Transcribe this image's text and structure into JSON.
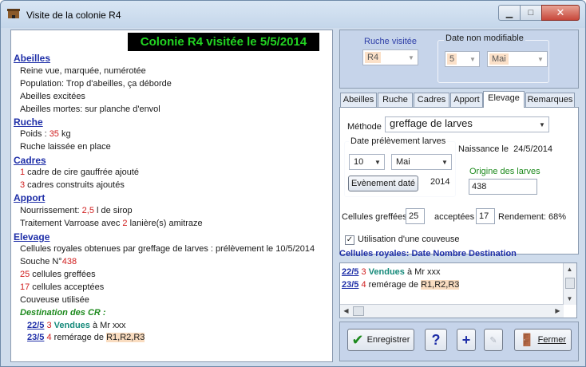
{
  "window": {
    "title": "Visite de la colonie R4"
  },
  "left": {
    "banner": "Colonie R4 visitée le 5/5/2014",
    "abeilles": {
      "heading": "Abeilles",
      "lines": [
        "Reine vue, marquée, numérotée",
        "Population: Trop d'abeilles, ça déborde",
        "Abeilles excitées",
        "Abeilles mortes:  sur planche d'envol"
      ]
    },
    "ruche": {
      "heading": "Ruche",
      "poids_label": "Poids : ",
      "poids_value": "35",
      "poids_unit": "  kg",
      "line2": "Ruche laissée en place"
    },
    "cadres": {
      "heading": "Cadres",
      "l1_num": "1",
      "l1_text": " cadre de cire gauffrée ajouté",
      "l2_num": "3",
      "l2_text": " cadres construits ajoutés"
    },
    "apport": {
      "heading": "Apport",
      "l1_label": "Nourrissement: ",
      "l1_value": "2,5",
      "l1_unit": "  l de sirop",
      "l2_label": "Traitement Varroase avec ",
      "l2_value": "2",
      "l2_unit": "  lanière(s) amitraze"
    },
    "elevage": {
      "heading": "Elevage",
      "l1": "Cellules royales obtenues par greffage de larves :  prélèvement  le 10/5/2014",
      "l2_label": "Souche N°",
      "l2_value": "438",
      "l3_num": "25",
      "l3_text": " cellules greffées",
      "l4_num": "17",
      "l4_text": " cellules acceptées",
      "l5": "Couveuse utilisée",
      "dest_title": "Destination des CR :",
      "d1_date": "22/5",
      "d1_num": "3",
      "d1_status": "Vendues",
      "d1_rest": " à Mr xxx",
      "d2_date": "23/5",
      "d2_num": "4",
      "d2_status": " remérage de ",
      "d2_target": "R1,R2,R3"
    }
  },
  "right": {
    "ruche_visitee_label": "Ruche visitée",
    "ruche_visitee_value": "R4",
    "date_label": "Date non modifiable",
    "date_day": "5",
    "date_month": "Mai",
    "tabs": [
      "Abeilles",
      "Ruche",
      "Cadres",
      "Apport",
      "Elevage",
      "Remarques"
    ],
    "active_tab": "Elevage",
    "methode_label": "Méthode",
    "methode_value": "greffage de larves",
    "prelevement_label": "Date prélèvement larves",
    "prel_day": "10",
    "prel_month": "Mai",
    "prel_year": "2014",
    "event_button": "Evènement daté",
    "naissance_label": "Naissance le",
    "naissance_value": "24/5/2014",
    "origine_label": "Origine des larves",
    "origine_value": "438",
    "greffees_label": "Cellules greffées",
    "greffees_value": "25",
    "acceptees_label": "acceptées",
    "acceptees_value": "17",
    "rendement_label": "Rendement:",
    "rendement_value": "68%",
    "couveuse_label": "Utilisation d'une couveuse",
    "cr_header": "Cellules royales: Date Nombre Destination",
    "cr_rows": [
      {
        "date": "22/5",
        "num": "3",
        "status": "Vendues",
        "rest": " à Mr xxx"
      },
      {
        "date": "23/5",
        "num": "4",
        "status": " remérage de ",
        "target": "R1,R2,R3"
      }
    ],
    "buttons": {
      "enregistrer": "Enregistrer",
      "help": "?",
      "add": "+",
      "fermer": "Fermer"
    }
  },
  "colors": {
    "banner_bg": "#000000",
    "banner_fg": "#22d422",
    "section": "#1f2fa8",
    "red_value": "#d01e1e",
    "panel_bg": "#c6d4ea"
  }
}
